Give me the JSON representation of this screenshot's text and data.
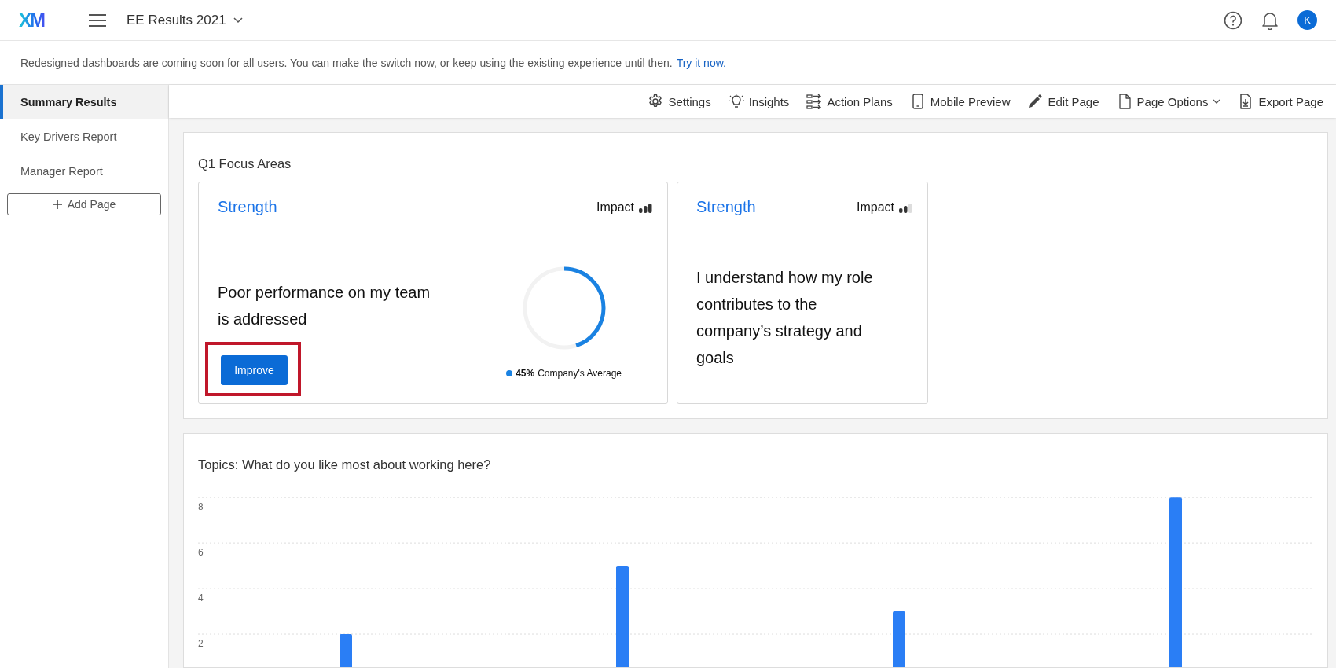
{
  "header": {
    "logo": "XM",
    "project_title": "EE Results 2021",
    "avatar_initial": "K"
  },
  "banner": {
    "text": "Redesigned dashboards are coming soon for all users. You can make the switch now, or keep using the existing experience until then.",
    "link": "Try it now."
  },
  "sidebar": {
    "items": [
      {
        "label": "Summary Results",
        "selected": true
      },
      {
        "label": "Key Drivers Report",
        "selected": false
      },
      {
        "label": "Manager Report",
        "selected": false
      }
    ],
    "add_button": "Add Page"
  },
  "toolbar": [
    {
      "kind": "settings",
      "label": "Settings"
    },
    {
      "kind": "insights",
      "label": "Insights"
    },
    {
      "kind": "plans",
      "label": "Action Plans"
    },
    {
      "kind": "mobile",
      "label": "Mobile Preview"
    },
    {
      "kind": "edit",
      "label": "Edit Page"
    },
    {
      "kind": "options",
      "label": "Page Options"
    },
    {
      "kind": "export",
      "label": "Export Page"
    }
  ],
  "focus_panel": {
    "title": "Q1 Focus Areas",
    "cards": [
      {
        "heading": "Strength",
        "impact_label": "Impact",
        "impact": {
          "level": 1
        },
        "statement": "Poor performance on my team is addressed",
        "gauge": {
          "level": 0.45,
          "value": "45%",
          "caption": "Company's Average",
          "color": "#1a82e2"
        },
        "button": {
          "label": "Improve",
          "highlighted": true
        }
      },
      {
        "heading": "Strength",
        "impact_label": "Impact",
        "impact": {
          "level": 0.67
        },
        "statement": "I understand how my role contributes to the company’s strategy and goals"
      }
    ]
  },
  "topics_panel": {
    "chart_data": {
      "title": "Topics: What do you like most about working here?",
      "type": "bar",
      "values": [
        2,
        5,
        3,
        8
      ],
      "ylim": [
        0,
        10.8
      ],
      "yticks": [
        2,
        4,
        6,
        8
      ],
      "grid": true
    }
  }
}
